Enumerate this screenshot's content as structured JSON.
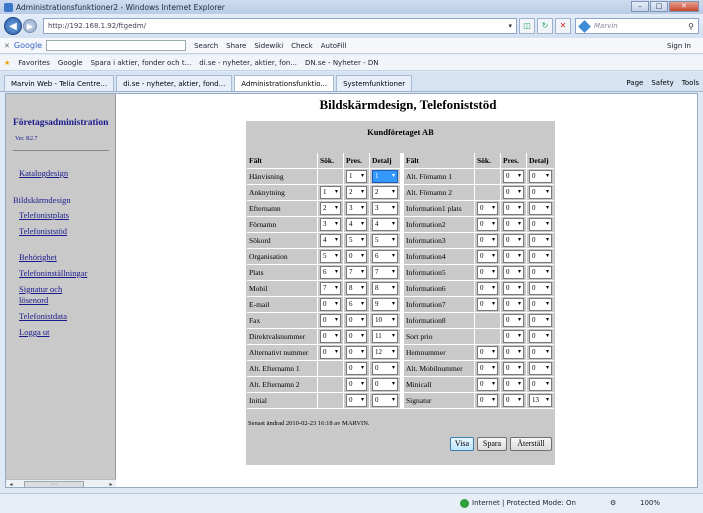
{
  "window": {
    "title": "Administrationsfunktioner2 - Windows Internet Explorer"
  },
  "address": {
    "url": "http://192.168.1.92/ftgedm/",
    "search_placeholder": "Marvin"
  },
  "google_bar": {
    "logo": "Google",
    "search": "Search",
    "share": "Share",
    "sidewiki": "Sidewiki",
    "check": "Check",
    "autofill": "AutoFill",
    "signin": "Sign In"
  },
  "favorites": {
    "label": "Favorites",
    "items": [
      "Google",
      "Spara i aktier, fonder och t...",
      "di.se - nyheter, aktier, fon...",
      "DN.se - Nyheter - DN"
    ]
  },
  "tabs": {
    "items": [
      "Marvin Web - Telia Centre...",
      "di.se - nyheter, aktier, fond...",
      "Administrationsfunktio...",
      "Systemfunktioner"
    ],
    "tools": [
      "Page",
      "Safety",
      "Tools"
    ]
  },
  "sidebar": {
    "title": "Företagsadministration",
    "version": "Ver. R2.7",
    "links": {
      "katalog": "Katalogdesign",
      "heading": "Bildskärmdesign",
      "telefonistplats": "Telefonistplats",
      "telefoniststod": "Telefoniststöd",
      "behorighet": "Behörighet",
      "installningar": "Telefoninställningar",
      "signatur1": "Signatur och",
      "signatur2": "lösenord",
      "telefonistdata": "Telefonistdata",
      "logout": "Logga ut"
    }
  },
  "page": {
    "title": "Bildskärmdesign, Telefoniststöd",
    "company": "Kundföretaget AB"
  },
  "table": {
    "headers": {
      "falt": "Fält",
      "sok": "Sök.",
      "pres": "Pres.",
      "detalj": "Detalj"
    },
    "left": [
      {
        "label": "Hänvisning",
        "sok": "",
        "pres": "1",
        "det": "1",
        "hi": true
      },
      {
        "label": "Anknytning",
        "sok": "1",
        "pres": "2",
        "det": "2"
      },
      {
        "label": "Efternamn",
        "sok": "2",
        "pres": "3",
        "det": "3"
      },
      {
        "label": "Förnamn",
        "sok": "3",
        "pres": "4",
        "det": "4"
      },
      {
        "label": "Sökord",
        "sok": "4",
        "pres": "5",
        "det": "5"
      },
      {
        "label": "Organisation",
        "sok": "5",
        "pres": "0",
        "det": "6"
      },
      {
        "label": "Plats",
        "sok": "6",
        "pres": "7",
        "det": "7"
      },
      {
        "label": "Mobil",
        "sok": "7",
        "pres": "8",
        "det": "8"
      },
      {
        "label": "E-mail",
        "sok": "0",
        "pres": "6",
        "det": "9"
      },
      {
        "label": "Fax",
        "sok": "0",
        "pres": "0",
        "det": "10"
      },
      {
        "label": "Direktvalsnummer",
        "sok": "0",
        "pres": "0",
        "det": "11"
      },
      {
        "label": "Alternativt nummer",
        "sok": "0",
        "pres": "0",
        "det": "12"
      },
      {
        "label": "Alt. Efternamn 1",
        "sok": "",
        "pres": "0",
        "det": "0"
      },
      {
        "label": "Alt. Efternamn 2",
        "sok": "",
        "pres": "0",
        "det": "0"
      },
      {
        "label": "Initial",
        "sok": "",
        "pres": "0",
        "det": "0"
      }
    ],
    "right": [
      {
        "label": "Alt. Förnamn 1",
        "sok": "",
        "pres": "0",
        "det": "0"
      },
      {
        "label": "Alt. Förnamn 2",
        "sok": "",
        "pres": "0",
        "det": "0"
      },
      {
        "label": "Information1 plats",
        "sok": "0",
        "pres": "0",
        "det": "0"
      },
      {
        "label": "Information2",
        "sok": "0",
        "pres": "0",
        "det": "0"
      },
      {
        "label": "Information3",
        "sok": "0",
        "pres": "0",
        "det": "0"
      },
      {
        "label": "Information4",
        "sok": "0",
        "pres": "0",
        "det": "0"
      },
      {
        "label": "Information5",
        "sok": "0",
        "pres": "0",
        "det": "0"
      },
      {
        "label": "Information6",
        "sok": "0",
        "pres": "0",
        "det": "0"
      },
      {
        "label": "Information7",
        "sok": "0",
        "pres": "0",
        "det": "0"
      },
      {
        "label": "Information8",
        "sok": "",
        "pres": "0",
        "det": "0"
      },
      {
        "label": "Sort prio",
        "sok": "",
        "pres": "0",
        "det": "0"
      },
      {
        "label": "Hemnummer",
        "sok": "0",
        "pres": "0",
        "det": "0"
      },
      {
        "label": "Alt. Mobilnummer",
        "sok": "0",
        "pres": "0",
        "det": "0"
      },
      {
        "label": "Minicall",
        "sok": "0",
        "pres": "0",
        "det": "0"
      },
      {
        "label": "Signatur",
        "sok": "0",
        "pres": "0",
        "det": "13"
      }
    ]
  },
  "footer": {
    "changed": "Senast ändrad 2010-02-23 16:18 av MARVIN."
  },
  "buttons": {
    "visa": "Visa",
    "spara": "Spara",
    "aterstall": "Återställ"
  },
  "status": {
    "zone": "Internet | Protected Mode: On",
    "zoom": "100%"
  }
}
